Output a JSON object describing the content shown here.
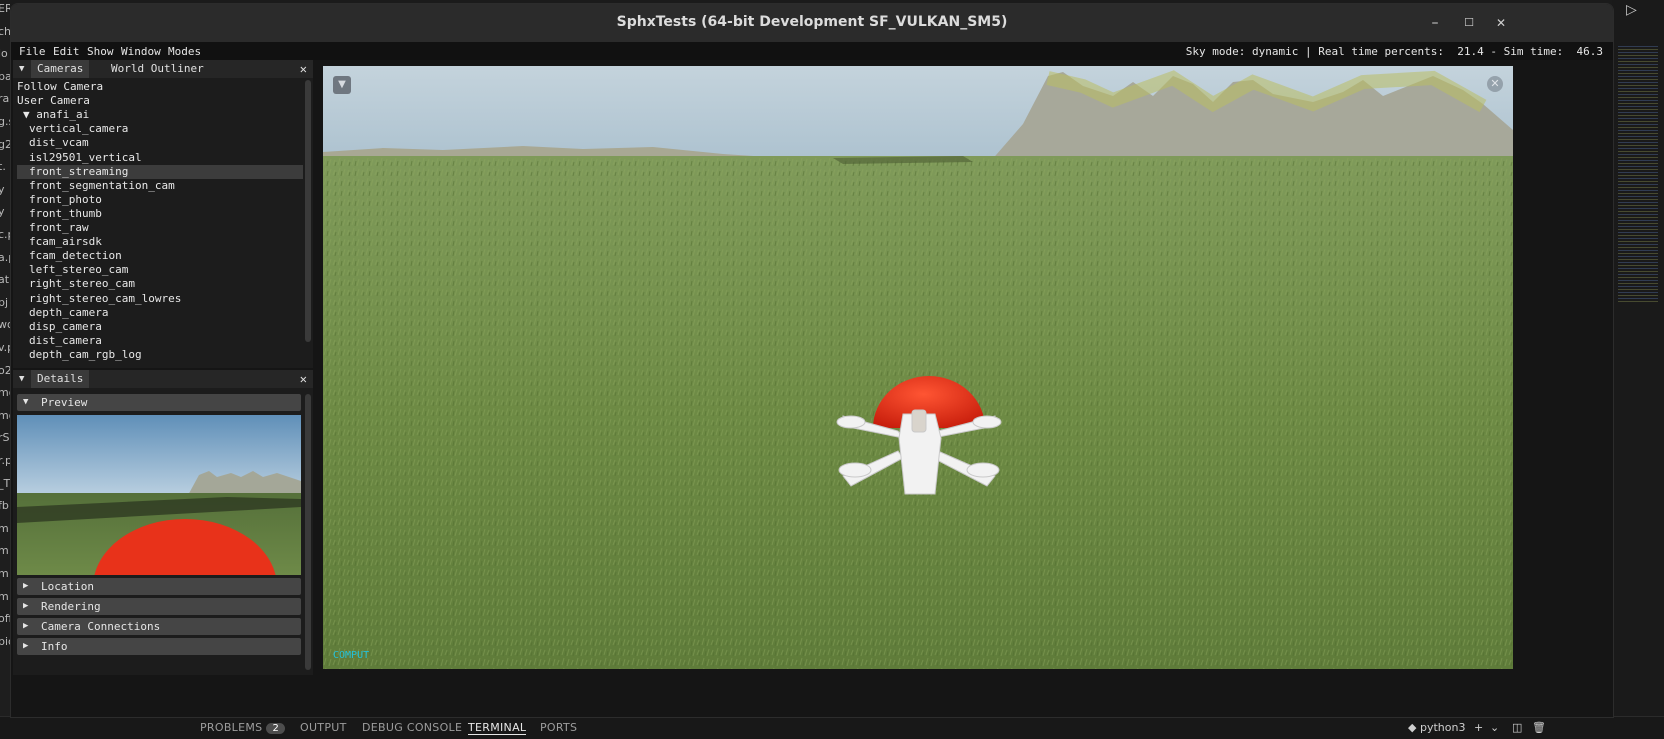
{
  "ide": {
    "left_fragments": [
      "ER",
      "ch",
      "lo",
      "pa",
      "ra",
      "g.s",
      "g2",
      "t.",
      "y",
      "y",
      "c.p",
      "a.p",
      "at",
      "bj",
      "wo",
      "v.p",
      "o2",
      "mo",
      "mo",
      "rS",
      "r.p",
      "_T",
      "fb",
      "m",
      "m",
      "m",
      "m",
      "off",
      "pic.py"
    ],
    "bottom_tabs": [
      "PROBLEMS",
      "OUTPUT",
      "DEBUG CONSOLE",
      "TERMINAL",
      "PORTS"
    ],
    "problems_count": "2",
    "terminal_name": "python3"
  },
  "window": {
    "title": "SphxTests (64-bit Development SF_VULKAN_SM5)",
    "minimize": "–",
    "maximize": "☐",
    "close": "✕"
  },
  "menu": {
    "items": [
      "File",
      "Edit",
      "Show",
      "Window",
      "Modes"
    ],
    "status": "Sky mode: dynamic | Real time percents:  21.4 - Sim time:  46.3"
  },
  "cameras_panel": {
    "tabs": [
      "Cameras",
      "World Outliner"
    ],
    "close": "✕",
    "items": [
      {
        "label": "Follow Camera",
        "indent": 0
      },
      {
        "label": "User Camera",
        "indent": 0
      },
      {
        "label": "▼ anafi_ai",
        "indent": 1
      },
      {
        "label": "vertical_camera",
        "indent": 2
      },
      {
        "label": "dist_vcam",
        "indent": 2
      },
      {
        "label": "isl29501_vertical",
        "indent": 2
      },
      {
        "label": "front_streaming",
        "indent": 2,
        "selected": true
      },
      {
        "label": "front_segmentation_cam",
        "indent": 2
      },
      {
        "label": "front_photo",
        "indent": 2
      },
      {
        "label": "front_thumb",
        "indent": 2
      },
      {
        "label": "front_raw",
        "indent": 2
      },
      {
        "label": "fcam_airsdk",
        "indent": 2
      },
      {
        "label": "fcam_detection",
        "indent": 2
      },
      {
        "label": "left_stereo_cam",
        "indent": 2
      },
      {
        "label": "right_stereo_cam",
        "indent": 2
      },
      {
        "label": "right_stereo_cam_lowres",
        "indent": 2
      },
      {
        "label": "depth_camera",
        "indent": 2
      },
      {
        "label": "disp_camera",
        "indent": 2
      },
      {
        "label": "dist_camera",
        "indent": 2
      },
      {
        "label": "depth_cam_rgb_log",
        "indent": 2
      }
    ]
  },
  "details_panel": {
    "tab": "Details",
    "close": "✕",
    "sections": [
      {
        "label": "Preview",
        "expanded": true
      },
      {
        "label": "Location",
        "expanded": false
      },
      {
        "label": "Rendering",
        "expanded": false
      },
      {
        "label": "Camera Connections",
        "expanded": false
      },
      {
        "label": "Info",
        "expanded": false
      }
    ]
  },
  "viewport": {
    "menu_icon": "▼",
    "close_icon": "✕",
    "watermark": "COMPUT"
  },
  "colors": {
    "sky_top": "#b4c9d6",
    "grass": "#6e8a42",
    "balloon": "#e8321a",
    "drone": "#f2f2f2",
    "selection": "#3c3c3c"
  }
}
